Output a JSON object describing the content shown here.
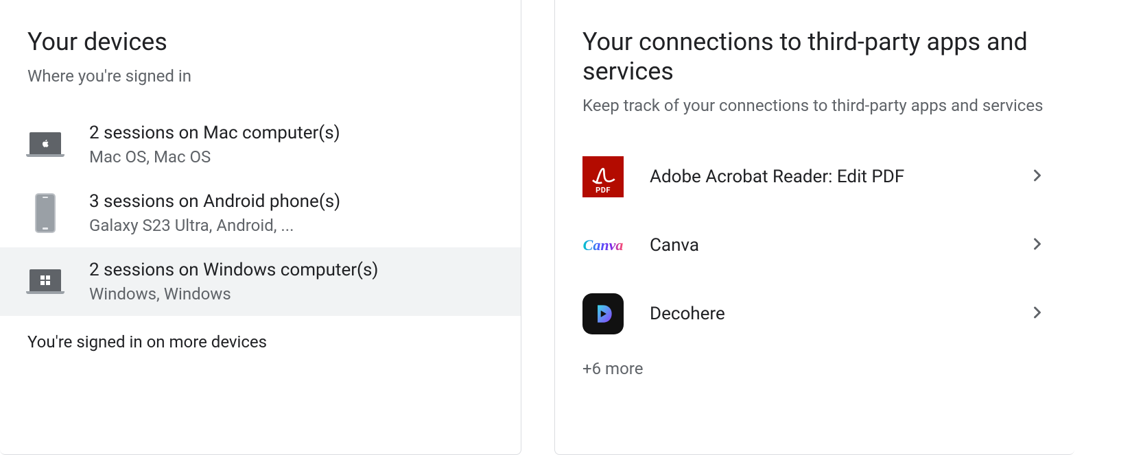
{
  "devices_card": {
    "title": "Your devices",
    "subtitle": "Where you're signed in",
    "items": [
      {
        "title": "2 sessions on Mac computer(s)",
        "sub": "Mac OS, Mac OS",
        "icon": "mac-laptop"
      },
      {
        "title": "3 sessions on Android phone(s)",
        "sub": "Galaxy S23 Ultra, Android, ...",
        "icon": "android-phone"
      },
      {
        "title": "2 sessions on Windows computer(s)",
        "sub": "Windows, Windows",
        "icon": "windows-laptop"
      }
    ],
    "more_text": "You're signed in on more devices"
  },
  "connections_card": {
    "title": "Your connections to third-party apps and services",
    "subtitle": "Keep track of your connections to third-party apps and services",
    "items": [
      {
        "name": "Adobe Acrobat Reader: Edit PDF",
        "icon": "adobe-acrobat"
      },
      {
        "name": "Canva",
        "icon": "canva"
      },
      {
        "name": "Decohere",
        "icon": "decohere"
      }
    ],
    "more_text": "+6 more"
  }
}
